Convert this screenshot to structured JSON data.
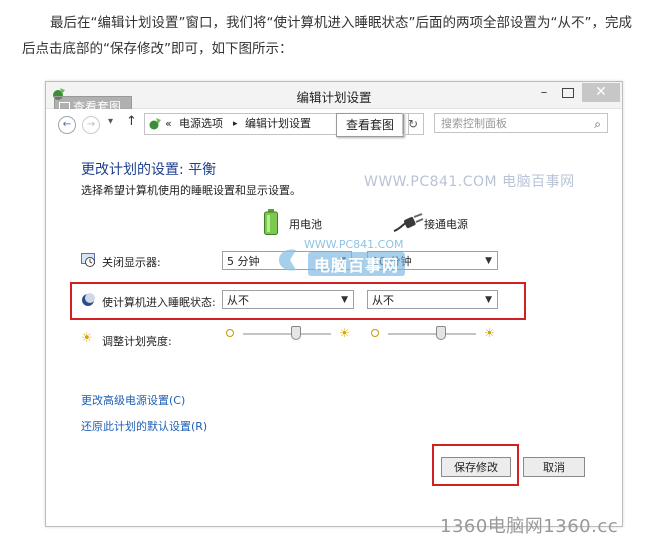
{
  "article": {
    "intro": "最后在“编辑计划设置”窗口，我们将“使计算机进入睡眠状态”后面的两项全部设置为“从不”，完成后点击底部的“保存修改”即可，如下图所示："
  },
  "window": {
    "title": "编辑计划设置",
    "tooltip": "查看套图",
    "close_glyph": "✕",
    "min_glyph": "–"
  },
  "address": {
    "back_glyph": "←",
    "forward_glyph": "→",
    "dropdown_glyph": "▾",
    "up_glyph": "↑",
    "chevrons": "«",
    "crumb1": "电源选项",
    "separator": "▸",
    "crumb2": "编辑计划设置",
    "view_tag": "查看套图",
    "refresh_glyph": "↻",
    "search_placeholder": "搜索控制面板",
    "search_glyph": "⌕"
  },
  "content": {
    "heading": "更改计划的设置: 平衡",
    "subheading": "选择希望计算机使用的睡眠设置和显示设置。",
    "watermark_site": "WWW.PC841.COM 电脑百事网",
    "col_battery": "用电池",
    "col_plugged": "接通电源",
    "watermark_small": "WWW.PC841.COM",
    "watermark_brand": "电脑百事网",
    "rows": {
      "display": {
        "label": "关闭显示器:",
        "battery": "5 分钟",
        "plugged": "10 分钟"
      },
      "sleep": {
        "label": "使计算机进入睡眠状态:",
        "battery": "从不",
        "plugged": "从不"
      },
      "brightness": {
        "label": "调整计划亮度:"
      }
    },
    "brightness": {
      "battery_level": 0.6,
      "plugged_level": 0.6
    },
    "link_advanced": "更改高级电源设置(C)",
    "link_restore": "还原此计划的默认设置(R)",
    "save_button": "保存修改",
    "cancel_button": "取消"
  },
  "footer": {
    "watermark": "1360电脑网1360.cc"
  },
  "colors": {
    "heading": "#1e3f8f",
    "link": "#1d5fb3",
    "highlight": "#d02020"
  }
}
